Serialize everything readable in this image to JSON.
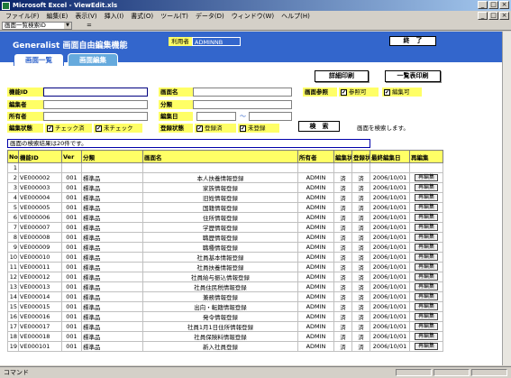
{
  "window": {
    "title": "Microsoft Excel - ViewEdit.xls"
  },
  "menu": {
    "items": [
      "ファイル(F)",
      "編集(E)",
      "表示(V)",
      "挿入(I)",
      "書式(O)",
      "ツール(T)",
      "データ(D)",
      "ウィンドウ(W)",
      "ヘルプ(H)"
    ]
  },
  "formula": {
    "namebox": "画面一覧検索ID",
    "fx": "="
  },
  "header": {
    "brand": "Generalist 画面自由編集機能",
    "user_label": "利用者",
    "user_value": "ADMINNB",
    "exit_label": "終　了"
  },
  "tabs": [
    {
      "label": "画面一覧"
    },
    {
      "label": "画面編集"
    }
  ],
  "actions": {
    "detail_print": "詳細印刷",
    "list_print": "一覧表印刷"
  },
  "search": {
    "func_id_label": "機能ID",
    "func_id_value": "",
    "screen_name_label": "画面名",
    "screen_name_value": "",
    "ref_label": "画面参照",
    "ref_ok": "参照可",
    "edit_ok": "編集可",
    "editor_label": "編集者",
    "editor_value": "",
    "category_label": "分類",
    "category_value": "",
    "owner_label": "所有者",
    "owner_value": "",
    "edit_date_label": "編集日",
    "edit_date_sep": "～",
    "edit_status_label": "編集状態",
    "checked": "チェック済",
    "unchecked": "未チェック",
    "reg_status_label": "登録状態",
    "registered": "登録済",
    "unregistered": "未登録",
    "search_button": "検　索",
    "search_hint": "画面を検索します。"
  },
  "result_message": "画面の検索結果は20件です。",
  "table": {
    "headers": [
      "No",
      "機能ID",
      "Ver",
      "分類",
      "画面名",
      "所有者",
      "編集状態",
      "登録状態",
      "最終編集日",
      "再編集"
    ],
    "edit_label": "再編集",
    "rows": [
      [
        "1",
        "",
        "",
        "",
        "",
        "",
        "",
        "",
        "",
        ""
      ],
      [
        "2",
        "VE000002",
        "001",
        "標準品",
        "本人扶養情報登録",
        "ADMIN",
        "済",
        "済",
        "2006/10/01",
        "再編集"
      ],
      [
        "3",
        "VE000003",
        "001",
        "標準品",
        "家族情報登録",
        "ADMIN",
        "済",
        "済",
        "2006/10/01",
        "再編集"
      ],
      [
        "4",
        "VE000004",
        "001",
        "標準品",
        "旧姓情報登録",
        "ADMIN",
        "済",
        "済",
        "2006/10/01",
        "再編集"
      ],
      [
        "5",
        "VE000005",
        "001",
        "標準品",
        "国籍情報登録",
        "ADMIN",
        "済",
        "済",
        "2006/10/01",
        "再編集"
      ],
      [
        "6",
        "VE000006",
        "001",
        "標準品",
        "住所情報登録",
        "ADMIN",
        "済",
        "済",
        "2006/10/01",
        "再編集"
      ],
      [
        "7",
        "VE000007",
        "001",
        "標準品",
        "学歴情報登録",
        "ADMIN",
        "済",
        "済",
        "2006/10/01",
        "再編集"
      ],
      [
        "8",
        "VE000008",
        "001",
        "標準品",
        "職歴情報登録",
        "ADMIN",
        "済",
        "済",
        "2006/10/01",
        "再編集"
      ],
      [
        "9",
        "VE000009",
        "001",
        "標準品",
        "職種情報登録",
        "ADMIN",
        "済",
        "済",
        "2006/10/01",
        "再編集"
      ],
      [
        "10",
        "VE000010",
        "001",
        "標準品",
        "社員基本情報登録",
        "ADMIN",
        "済",
        "済",
        "2006/10/01",
        "再編集"
      ],
      [
        "11",
        "VE000011",
        "001",
        "標準品",
        "社員扶養情報登録",
        "ADMIN",
        "済",
        "済",
        "2006/10/01",
        "再編集"
      ],
      [
        "12",
        "VE000012",
        "001",
        "標準品",
        "社員給与振込情報登録",
        "ADMIN",
        "済",
        "済",
        "2006/10/01",
        "再編集"
      ],
      [
        "13",
        "VE000013",
        "001",
        "標準品",
        "社員住民税情報登録",
        "ADMIN",
        "済",
        "済",
        "2006/10/01",
        "再編集"
      ],
      [
        "14",
        "VE000014",
        "001",
        "標準品",
        "兼務情報登録",
        "ADMIN",
        "済",
        "済",
        "2006/10/01",
        "再編集"
      ],
      [
        "15",
        "VE000015",
        "001",
        "標準品",
        "出向・転籍情報登録",
        "ADMIN",
        "済",
        "済",
        "2006/10/01",
        "再編集"
      ],
      [
        "16",
        "VE000016",
        "001",
        "標準品",
        "発令情報登録",
        "ADMIN",
        "済",
        "済",
        "2006/10/01",
        "再編集"
      ],
      [
        "17",
        "VE000017",
        "001",
        "標準品",
        "社員1月1日住所情報登録",
        "ADMIN",
        "済",
        "済",
        "2006/10/01",
        "再編集"
      ],
      [
        "18",
        "VE000018",
        "001",
        "標準品",
        "社員保険料情報登録",
        "ADMIN",
        "済",
        "済",
        "2006/10/01",
        "再編集"
      ],
      [
        "19",
        "VE000101",
        "001",
        "標準品",
        "新入社員登録",
        "ADMIN",
        "済",
        "済",
        "2006/10/01",
        "再編集"
      ]
    ]
  },
  "status": {
    "mode": "コマンド"
  }
}
